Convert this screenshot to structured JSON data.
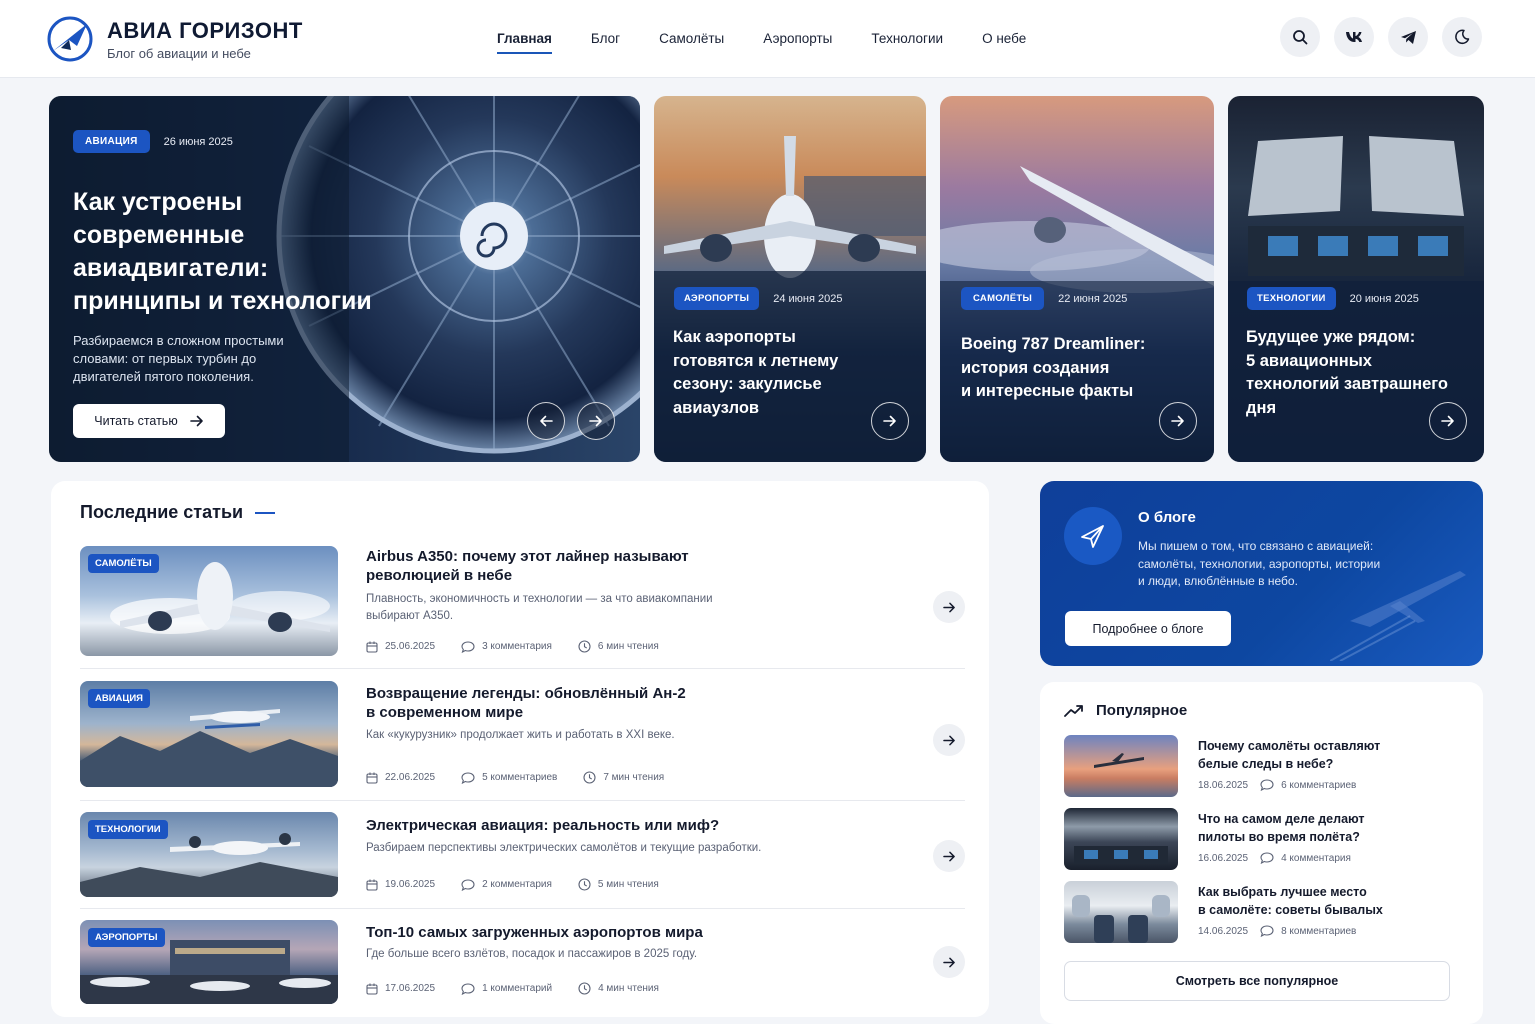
{
  "site": {
    "title": "АВИА ГОРИЗОНТ",
    "subtitle": "Блог об авиации и небе"
  },
  "nav": {
    "items": [
      "Главная",
      "Блог",
      "Самолёты",
      "Аэропорты",
      "Технологии",
      "О небе"
    ],
    "active": "Главная"
  },
  "header_icons": [
    "search-icon",
    "vk-icon",
    "telegram-icon",
    "moon-icon"
  ],
  "hero": {
    "badge": "АВИАЦИЯ",
    "date": "26 июня 2025",
    "title_lines": [
      "Как устроены",
      "современные",
      "авиадвигатели:",
      "принципы и технологии"
    ],
    "desc_lines": [
      "Разбираемся в сложном простыми",
      "словами: от первых турбин до",
      "двигателей пятого поколения."
    ],
    "button": "Читать статью"
  },
  "featured": [
    {
      "badge": "АЭРОПОРТЫ",
      "date": "24 июня 2025",
      "title_lines": [
        "Как аэропорты",
        "готовятся к летнему",
        "сезону: закулисье",
        "авиаузлов"
      ]
    },
    {
      "badge": "САМОЛЁТЫ",
      "date": "22 июня 2025",
      "title_lines": [
        "Boeing 787 Dreamliner:",
        "история создания",
        "и интересные факты"
      ]
    },
    {
      "badge": "ТЕХНОЛОГИИ",
      "date": "20 июня 2025",
      "title_lines": [
        "Будущее уже рядом:",
        "5 авиационных",
        "технологий завтрашнего",
        "дня"
      ]
    }
  ],
  "latest": {
    "heading": "Последние статьи",
    "articles": [
      {
        "badge": "САМОЛЁТЫ",
        "title_lines": [
          "Airbus A350: почему этот лайнер называют",
          "революцией в небе"
        ],
        "desc_lines": [
          "Плавность, экономичность и технологии — за что авиакомпании",
          "выбирают A350."
        ],
        "date": "25.06.2025",
        "comments": "3 комментария",
        "read": "6 мин чтения"
      },
      {
        "badge": "АВИАЦИЯ",
        "title_lines": [
          "Возвращение легенды: обновлённый Ан-2",
          "в современном мире"
        ],
        "desc_lines": [
          "Как «кукурузник» продолжает жить и работать в XXI веке."
        ],
        "date": "22.06.2025",
        "comments": "5 комментариев",
        "read": "7 мин чтения"
      },
      {
        "badge": "ТЕХНОЛОГИИ",
        "title_lines": [
          "Электрическая авиация: реальность или миф?"
        ],
        "desc_lines": [
          "Разбираем перспективы электрических самолётов и текущие разработки."
        ],
        "date": "19.06.2025",
        "comments": "2 комментария",
        "read": "5 мин чтения"
      },
      {
        "badge": "АЭРОПОРТЫ",
        "title_lines": [
          "Топ-10 самых загруженных аэропортов мира"
        ],
        "desc_lines": [
          "Где больше всего взлётов, посадок и пассажиров в 2025 году."
        ],
        "date": "17.06.2025",
        "comments": "1 комментарий",
        "read": "4 мин чтения"
      }
    ]
  },
  "about": {
    "title": "О блоге",
    "desc_lines": [
      "Мы пишем о том, что связано с авиацией:",
      "самолёты, технологии, аэропорты, истории",
      "и люди, влюблённые в небо."
    ],
    "button": "Подробнее о блоге"
  },
  "popular": {
    "heading": "Популярное",
    "items": [
      {
        "title_lines": [
          "Почему самолёты оставляют",
          "белые следы в небе?"
        ],
        "date": "18.06.2025",
        "comments": "6 комментариев"
      },
      {
        "title_lines": [
          "Что на самом деле делают",
          "пилоты во время полёта?"
        ],
        "date": "16.06.2025",
        "comments": "4 комментария"
      },
      {
        "title_lines": [
          "Как выбрать лучшее место",
          "в самолёте: советы бывалых"
        ],
        "date": "14.06.2025",
        "comments": "8 комментариев"
      }
    ],
    "button": "Смотреть все популярное"
  },
  "colors": {
    "accent": "#1c55c2",
    "dark_navy": "#0f2a5a",
    "about_bg": "#0d47a1"
  }
}
